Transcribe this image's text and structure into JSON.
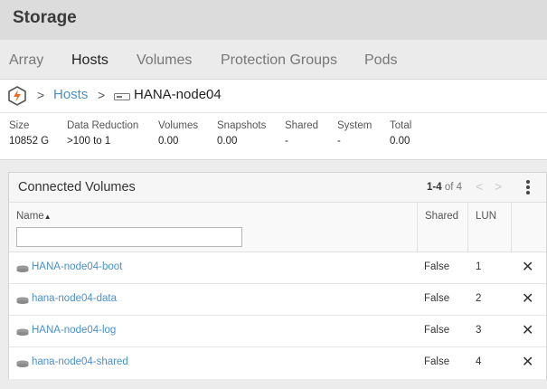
{
  "header": {
    "title": "Storage"
  },
  "tabs": [
    {
      "label": "Array"
    },
    {
      "label": "Hosts"
    },
    {
      "label": "Volumes"
    },
    {
      "label": "Protection Groups"
    },
    {
      "label": "Pods"
    }
  ],
  "active_tab": "Hosts",
  "breadcrumb": {
    "separator": ">",
    "link": "Hosts",
    "current": "HANA-node04"
  },
  "stats": [
    {
      "label": "Size",
      "value": "10852 G"
    },
    {
      "label": "Data Reduction",
      "value": ">100 to 1"
    },
    {
      "label": "Volumes",
      "value": "0.00"
    },
    {
      "label": "Snapshots",
      "value": "0.00"
    },
    {
      "label": "Shared",
      "value": "-"
    },
    {
      "label": "System",
      "value": "-"
    },
    {
      "label": "Total",
      "value": "0.00"
    }
  ],
  "panel": {
    "title": "Connected Volumes",
    "pager_range": "1-4",
    "pager_of": "of 4",
    "prev_glyph": "<",
    "next_glyph": ">",
    "columns": {
      "name": "Name",
      "sort_glyph": "▲",
      "shared": "Shared",
      "lun": "LUN"
    },
    "filter_value": "",
    "rows": [
      {
        "name": "HANA-node04-boot",
        "shared": "False",
        "lun": "1"
      },
      {
        "name": "hana-node04-data",
        "shared": "False",
        "lun": "2"
      },
      {
        "name": "HANA-node04-log",
        "shared": "False",
        "lun": "3"
      },
      {
        "name": "hana-node04-shared",
        "shared": "False",
        "lun": "4"
      }
    ],
    "remove_glyph": "✕"
  },
  "colors": {
    "accent": "#f06a21",
    "link": "#4a90c9"
  }
}
